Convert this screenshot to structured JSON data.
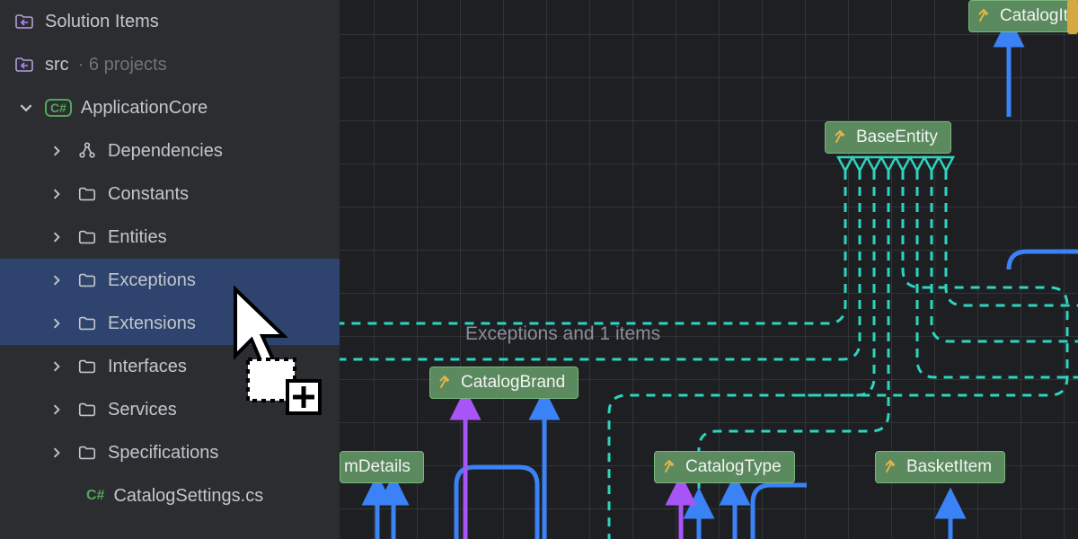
{
  "sidebar": {
    "solution_items": "Solution Items",
    "src": "src",
    "src_suffix": " · 6 projects",
    "project": "ApplicationCore",
    "folders": [
      "Dependencies",
      "Constants",
      "Entities",
      "Exceptions",
      "Extensions",
      "Interfaces",
      "Services",
      "Specifications"
    ],
    "file": "CatalogSettings.cs",
    "selected_indices": [
      3,
      4
    ]
  },
  "diagram": {
    "drag_label": "Exceptions and 1 items",
    "nodes": {
      "base_entity": "BaseEntity",
      "catalog_it": "CatalogIt",
      "catalog_brand": "CatalogBrand",
      "em_details": "mDetails",
      "catalog_type": "CatalogType",
      "basket_item": "BasketItem"
    }
  }
}
